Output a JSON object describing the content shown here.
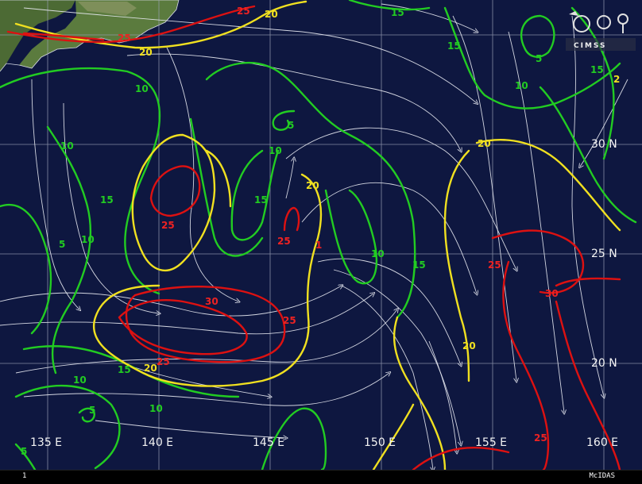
{
  "map": {
    "longitude_labels": [
      "135 E",
      "140 E",
      "145 E",
      "150 E",
      "155 E",
      "160 E"
    ],
    "latitude_labels": [
      "30 N",
      "25 N",
      "20 N"
    ],
    "contour_labels": {
      "red": [
        "25",
        "25",
        "25",
        "25",
        "30",
        "25",
        "25",
        "25",
        "30",
        "25"
      ],
      "yellow": [
        "20",
        "20",
        "20",
        "20",
        "20",
        "20",
        "20",
        "2",
        "1"
      ],
      "green": [
        "15",
        "15",
        "5",
        "10",
        "15",
        "10",
        "5",
        "10",
        "10",
        "15",
        "15",
        "5",
        "5",
        "10",
        "10",
        "15",
        "15",
        "10",
        "5",
        "5"
      ]
    },
    "colors": {
      "background": "#0e1740",
      "grid": "#9aa0b4",
      "red_contour": "#dd1111",
      "yellow_contour": "#f0e020",
      "green_contour": "#22cc22",
      "streamlines": "#e8eaf2",
      "land": "#4c6a34"
    },
    "logo": {
      "text": "CIMSS",
      "icon": "cimss-satellite-logo-icon"
    }
  },
  "status_bar": {
    "left": "1",
    "right": "McIDAS"
  }
}
